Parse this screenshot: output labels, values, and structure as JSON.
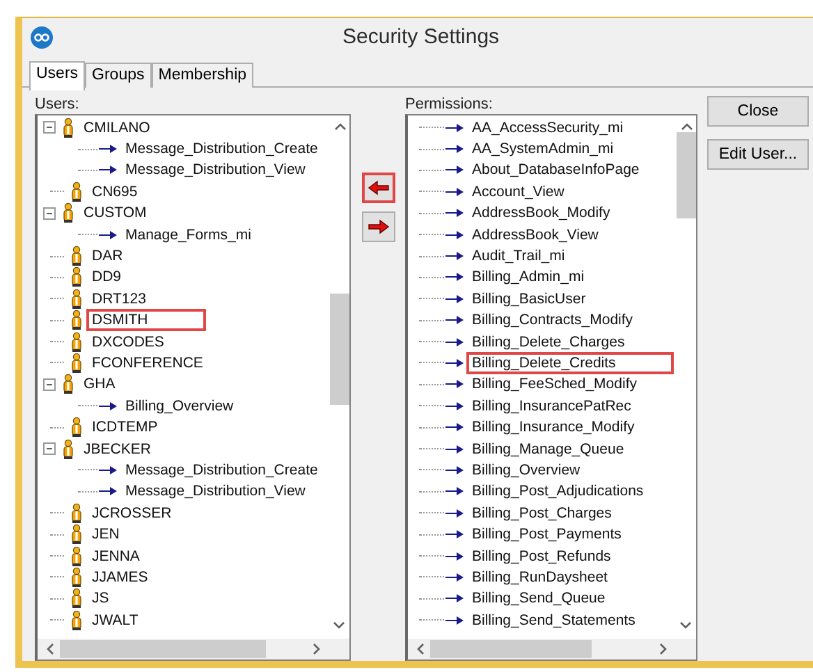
{
  "window": {
    "title": "Security Settings"
  },
  "tabs": [
    {
      "label": "Users",
      "selected": true
    },
    {
      "label": "Groups",
      "selected": false
    },
    {
      "label": "Membership",
      "selected": false
    }
  ],
  "users": {
    "label": "Users:",
    "items": [
      {
        "name": "CMILANO",
        "expanded": true,
        "highlighted": false,
        "children": [
          {
            "name": "Message_Distribution_Create"
          },
          {
            "name": "Message_Distribution_View"
          }
        ]
      },
      {
        "name": "CN695",
        "highlighted": false
      },
      {
        "name": "CUSTOM",
        "expanded": true,
        "highlighted": false,
        "children": [
          {
            "name": "Manage_Forms_mi"
          }
        ]
      },
      {
        "name": "DAR",
        "highlighted": false
      },
      {
        "name": "DD9",
        "highlighted": false
      },
      {
        "name": "DRT123",
        "highlighted": false
      },
      {
        "name": "DSMITH",
        "highlighted": true
      },
      {
        "name": "DXCODES",
        "highlighted": false
      },
      {
        "name": "FCONFERENCE",
        "highlighted": false
      },
      {
        "name": "GHA",
        "expanded": true,
        "highlighted": false,
        "children": [
          {
            "name": "Billing_Overview"
          }
        ]
      },
      {
        "name": "ICDTEMP",
        "highlighted": false
      },
      {
        "name": "JBECKER",
        "expanded": true,
        "highlighted": false,
        "children": [
          {
            "name": "Message_Distribution_Create"
          },
          {
            "name": "Message_Distribution_View"
          }
        ]
      },
      {
        "name": "JCROSSER",
        "highlighted": false
      },
      {
        "name": "JEN",
        "highlighted": false
      },
      {
        "name": "JENNA",
        "highlighted": false
      },
      {
        "name": "JJAMES",
        "highlighted": false
      },
      {
        "name": "JS",
        "highlighted": false
      },
      {
        "name": "JWALT",
        "highlighted": false
      }
    ]
  },
  "move_buttons": [
    {
      "kind": "left",
      "highlighted": true
    },
    {
      "kind": "right",
      "highlighted": false
    }
  ],
  "permissions": {
    "label": "Permissions:",
    "items": [
      {
        "name": "AA_AccessSecurity_mi",
        "highlighted": false
      },
      {
        "name": "AA_SystemAdmin_mi",
        "highlighted": false
      },
      {
        "name": "About_DatabaseInfoPage",
        "highlighted": false
      },
      {
        "name": "Account_View",
        "highlighted": false
      },
      {
        "name": "AddressBook_Modify",
        "highlighted": false
      },
      {
        "name": "AddressBook_View",
        "highlighted": false
      },
      {
        "name": "Audit_Trail_mi",
        "highlighted": false
      },
      {
        "name": "Billing_Admin_mi",
        "highlighted": false
      },
      {
        "name": "Billing_BasicUser",
        "highlighted": false
      },
      {
        "name": "Billing_Contracts_Modify",
        "highlighted": false
      },
      {
        "name": "Billing_Delete_Charges",
        "highlighted": false
      },
      {
        "name": "Billing_Delete_Credits",
        "highlighted": true
      },
      {
        "name": "Billing_FeeSched_Modify",
        "highlighted": false
      },
      {
        "name": "Billing_InsurancePatRec",
        "highlighted": false
      },
      {
        "name": "Billing_Insurance_Modify",
        "highlighted": false
      },
      {
        "name": "Billing_Manage_Queue",
        "highlighted": false
      },
      {
        "name": "Billing_Overview",
        "highlighted": false
      },
      {
        "name": "Billing_Post_Adjudications",
        "highlighted": false
      },
      {
        "name": "Billing_Post_Charges",
        "highlighted": false
      },
      {
        "name": "Billing_Post_Payments",
        "highlighted": false
      },
      {
        "name": "Billing_Post_Refunds",
        "highlighted": false
      },
      {
        "name": "Billing_RunDaysheet",
        "highlighted": false
      },
      {
        "name": "Billing_Send_Queue",
        "highlighted": false
      },
      {
        "name": "Billing_Send_Statements",
        "highlighted": false
      }
    ]
  },
  "buttons": [
    {
      "label": "Close"
    },
    {
      "label": "Edit User..."
    }
  ]
}
